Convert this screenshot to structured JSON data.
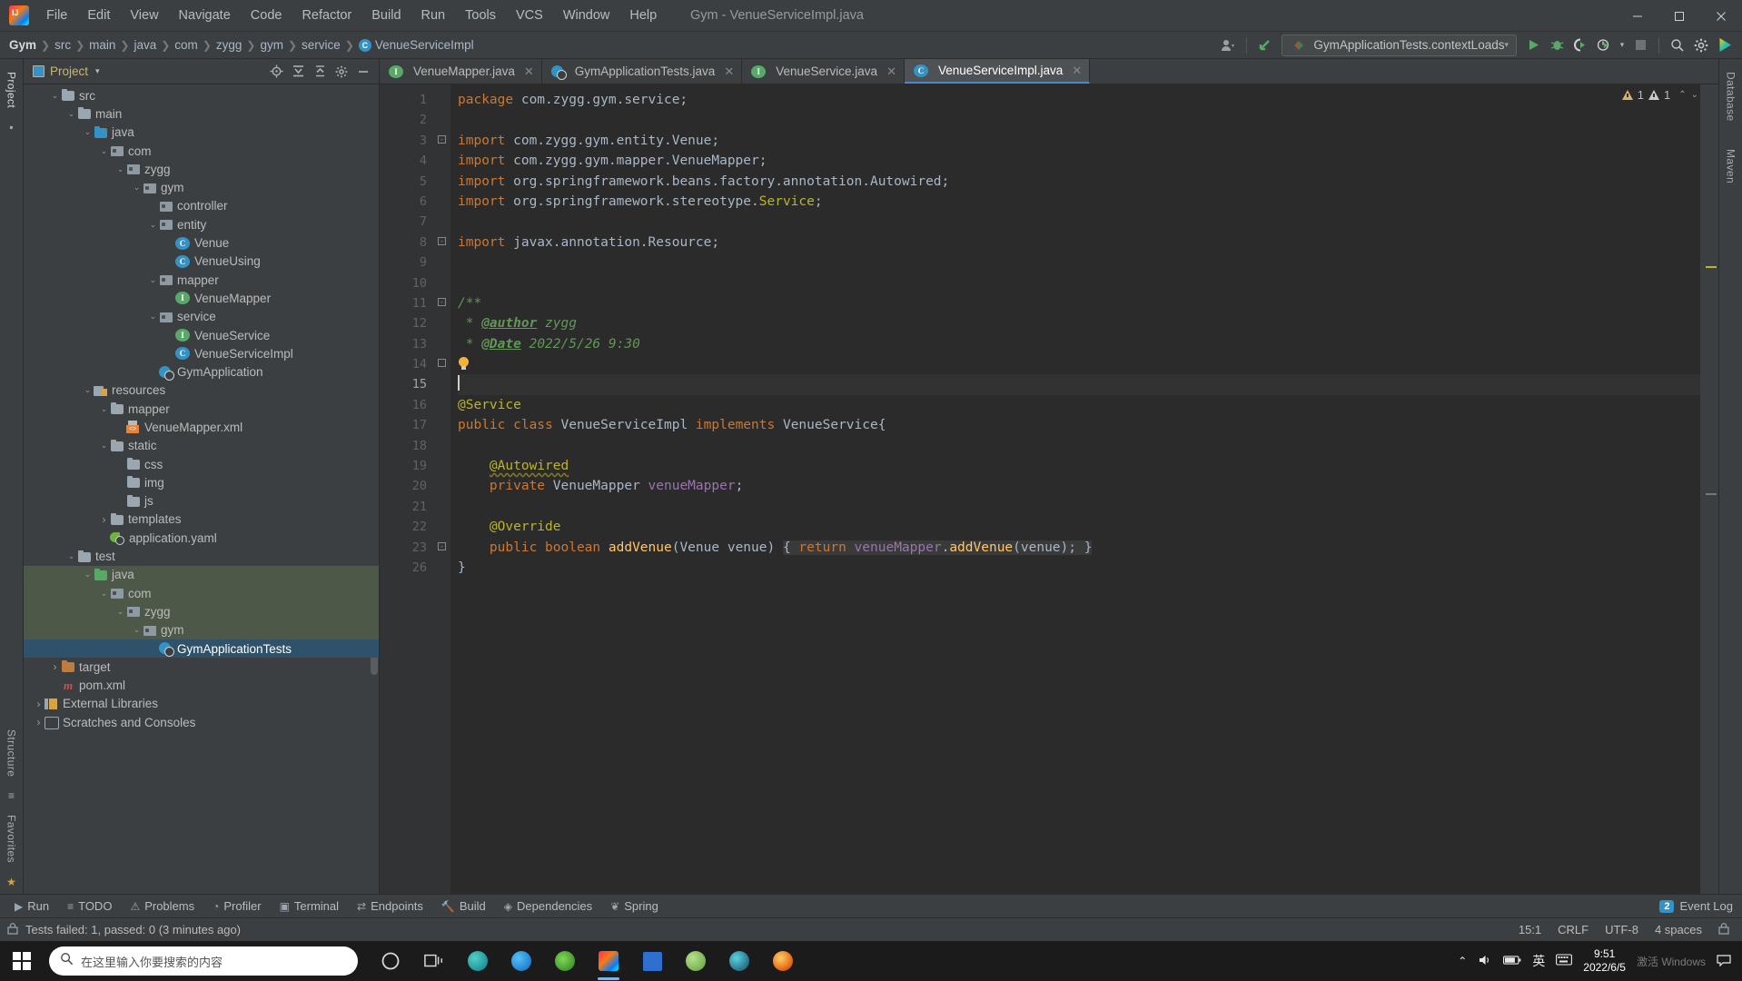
{
  "window": {
    "title": "Gym - VenueServiceImpl.java",
    "minimize": "–",
    "maximize": "▢",
    "close": "✕"
  },
  "menu": {
    "items": [
      "File",
      "Edit",
      "View",
      "Navigate",
      "Code",
      "Refactor",
      "Build",
      "Run",
      "Tools",
      "VCS",
      "Window",
      "Help"
    ]
  },
  "breadcrumb": {
    "items": [
      "Gym",
      "src",
      "main",
      "java",
      "com",
      "zygg",
      "gym",
      "service"
    ],
    "leaf": "VenueServiceImpl",
    "leaf_icon_letter": "C",
    "separator": "❯"
  },
  "toolbar": {
    "run_config": "GymApplicationTests.contextLoads",
    "run_config_caret": "▾",
    "profile_icon": "user-profile",
    "vcs_update_icon": "vcs-update",
    "run_label": "▶",
    "debug_label": "debug",
    "coverage_label": "coverage",
    "profiler_label": "profiler",
    "stop_label": "■",
    "search_label": "search",
    "settings_label": "settings",
    "ide_label": "ide"
  },
  "left_rail": {
    "top": "Project",
    "bottom": [
      "Structure",
      "Favorites"
    ]
  },
  "right_rail": {
    "items": [
      "Database",
      "Maven"
    ]
  },
  "project_panel": {
    "title": "Project",
    "caret": "▾",
    "actions": [
      "locate-icon",
      "expand-all-icon",
      "collapse-all-icon",
      "settings-icon",
      "hide-icon"
    ],
    "tree": [
      {
        "label": "src",
        "depth": 1,
        "chev": "⌄",
        "icon": "folder",
        "state": "normal"
      },
      {
        "label": "main",
        "depth": 2,
        "chev": "⌄",
        "icon": "folder",
        "state": "normal"
      },
      {
        "label": "java",
        "depth": 3,
        "chev": "⌄",
        "icon": "folder-blue",
        "state": "normal"
      },
      {
        "label": "com",
        "depth": 4,
        "chev": "⌄",
        "icon": "pkg",
        "state": "normal"
      },
      {
        "label": "zygg",
        "depth": 5,
        "chev": "⌄",
        "icon": "pkg",
        "state": "normal"
      },
      {
        "label": "gym",
        "depth": 6,
        "chev": "⌄",
        "icon": "pkg",
        "state": "normal"
      },
      {
        "label": "controller",
        "depth": 7,
        "chev": "",
        "icon": "pkg",
        "state": "normal"
      },
      {
        "label": "entity",
        "depth": 7,
        "chev": "⌄",
        "icon": "pkg",
        "state": "normal"
      },
      {
        "label": "Venue",
        "depth": 8,
        "chev": "",
        "icon": "class",
        "state": "normal"
      },
      {
        "label": "VenueUsing",
        "depth": 8,
        "chev": "",
        "icon": "class",
        "state": "normal"
      },
      {
        "label": "mapper",
        "depth": 7,
        "chev": "⌄",
        "icon": "pkg",
        "state": "normal"
      },
      {
        "label": "VenueMapper",
        "depth": 8,
        "chev": "",
        "icon": "interface",
        "state": "normal"
      },
      {
        "label": "service",
        "depth": 7,
        "chev": "⌄",
        "icon": "pkg",
        "state": "normal"
      },
      {
        "label": "VenueService",
        "depth": 8,
        "chev": "",
        "icon": "interface",
        "state": "normal"
      },
      {
        "label": "VenueServiceImpl",
        "depth": 8,
        "chev": "",
        "icon": "class",
        "state": "normal"
      },
      {
        "label": "GymApplication",
        "depth": 7,
        "chev": "",
        "icon": "spring-class",
        "state": "normal"
      },
      {
        "label": "resources",
        "depth": 3,
        "chev": "⌄",
        "icon": "resources",
        "state": "normal"
      },
      {
        "label": "mapper",
        "depth": 4,
        "chev": "⌄",
        "icon": "folder",
        "state": "normal"
      },
      {
        "label": "VenueMapper.xml",
        "depth": 5,
        "chev": "",
        "icon": "xml",
        "state": "normal"
      },
      {
        "label": "static",
        "depth": 4,
        "chev": "⌄",
        "icon": "folder",
        "state": "normal"
      },
      {
        "label": "css",
        "depth": 5,
        "chev": "",
        "icon": "folder",
        "state": "normal"
      },
      {
        "label": "img",
        "depth": 5,
        "chev": "",
        "icon": "folder",
        "state": "normal"
      },
      {
        "label": "js",
        "depth": 5,
        "chev": "",
        "icon": "folder",
        "state": "normal"
      },
      {
        "label": "templates",
        "depth": 4,
        "chev": "›",
        "icon": "folder",
        "state": "normal"
      },
      {
        "label": "application.yaml",
        "depth": 4,
        "chev": "",
        "icon": "spring",
        "state": "normal"
      },
      {
        "label": "test",
        "depth": 2,
        "chev": "⌄",
        "icon": "folder",
        "state": "normal"
      },
      {
        "label": "java",
        "depth": 3,
        "chev": "⌄",
        "icon": "folder-green",
        "state": "green"
      },
      {
        "label": "com",
        "depth": 4,
        "chev": "⌄",
        "icon": "pkg",
        "state": "green"
      },
      {
        "label": "zygg",
        "depth": 5,
        "chev": "⌄",
        "icon": "pkg",
        "state": "green"
      },
      {
        "label": "gym",
        "depth": 6,
        "chev": "⌄",
        "icon": "pkg",
        "state": "green"
      },
      {
        "label": "GymApplicationTests",
        "depth": 7,
        "chev": "",
        "icon": "spring-class",
        "state": "selected"
      },
      {
        "label": "target",
        "depth": 1,
        "chev": "›",
        "icon": "folder-target",
        "state": "normal"
      },
      {
        "label": "pom.xml",
        "depth": 1,
        "chev": "",
        "icon": "maven",
        "state": "normal"
      },
      {
        "label": "External Libraries",
        "depth": 0,
        "chev": "›",
        "icon": "library",
        "state": "normal"
      },
      {
        "label": "Scratches and Consoles",
        "depth": 0,
        "chev": "›",
        "icon": "console",
        "state": "normal"
      }
    ]
  },
  "editor": {
    "tabs": [
      {
        "label": "VenueMapper.java",
        "icon": "interface",
        "active": false,
        "close": "✕"
      },
      {
        "label": "GymApplicationTests.java",
        "icon": "spring-class",
        "active": false,
        "close": "✕"
      },
      {
        "label": "VenueService.java",
        "icon": "interface",
        "active": false,
        "close": "✕"
      },
      {
        "label": "VenueServiceImpl.java",
        "icon": "class",
        "active": true,
        "close": "✕"
      }
    ],
    "inspection": {
      "warning_count": "1",
      "weak_warning_count": "1",
      "up_arrow": "⌃",
      "down_arrow": "⌄"
    },
    "line_numbers": [
      "1",
      "2",
      "3",
      "4",
      "5",
      "6",
      "7",
      "8",
      "9",
      "10",
      "11",
      "12",
      "13",
      "14",
      "15",
      "16",
      "17",
      "18",
      "19",
      "20",
      "21",
      "22",
      "23",
      "26"
    ],
    "current_line": "15",
    "lines": [
      "package com.zygg.gym.service;",
      "",
      "import com.zygg.gym.entity.Venue;",
      "import com.zygg.gym.mapper.VenueMapper;",
      "import org.springframework.beans.factory.annotation.Autowired;",
      "import org.springframework.stereotype.Service;",
      "",
      "import javax.annotation.Resource;",
      "",
      "",
      "/**",
      " * @author zygg",
      " * @Date 2022/5/26 9:30",
      " */",
      "",
      "@Service",
      "public class VenueServiceImpl implements VenueService{",
      "",
      "    @Autowired",
      "    private VenueMapper venueMapper;",
      "",
      "    @Override",
      "    public boolean addVenue(Venue venue) { return venueMapper.addVenue(venue); }",
      "}"
    ],
    "javadoc": {
      "author_tag": "@author",
      "author_value": "zygg",
      "date_tag": "@Date",
      "date_value": "2022/5/26 9:30"
    }
  },
  "bottom_toolwindows": {
    "items": [
      {
        "label": "Run",
        "icon": "▶"
      },
      {
        "label": "TODO",
        "icon": "≡"
      },
      {
        "label": "Problems",
        "icon": "⚠"
      },
      {
        "label": "Profiler",
        "icon": "◔"
      },
      {
        "label": "Terminal",
        "icon": "▣"
      },
      {
        "label": "Endpoints",
        "icon": "⇄"
      },
      {
        "label": "Build",
        "icon": "🔨"
      },
      {
        "label": "Dependencies",
        "icon": "◈"
      },
      {
        "label": "Spring",
        "icon": "❦"
      }
    ],
    "event_log": "Event Log",
    "event_log_count": "2"
  },
  "status_bar": {
    "message": "Tests failed: 1, passed: 0 (3 minutes ago)",
    "caret_position": "15:1",
    "line_separator": "CRLF",
    "encoding": "UTF-8",
    "indent": "4 spaces",
    "lock_icon": "lock-icon"
  },
  "taskbar": {
    "search_placeholder": "在这里输入你要搜索的内容",
    "search_icon": "search-icon",
    "apps": [
      "cortana-circle",
      "task-view",
      "browser-teal",
      "edge",
      "media-player",
      "intellij",
      "store",
      "paint",
      "ocean-app",
      "firefox"
    ],
    "tray": {
      "chevron": "⌃",
      "volume": "volume-icon",
      "battery": "battery-icon",
      "ime": "英",
      "ime2": "⌨",
      "time": "9:51",
      "date": "2022/6/5"
    },
    "watermark": "激活 Windows"
  }
}
